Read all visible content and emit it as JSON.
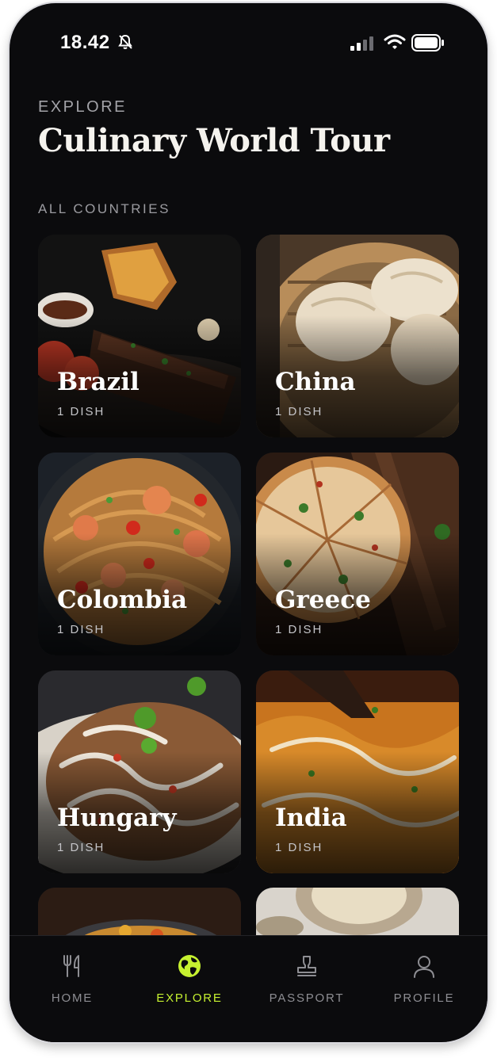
{
  "status_bar": {
    "time": "18.42",
    "icons": [
      "bell-slash-icon",
      "signal-icon",
      "wifi-icon",
      "battery-icon"
    ]
  },
  "header": {
    "eyebrow": "EXPLORE",
    "title": "Culinary World Tour"
  },
  "section_label": "ALL COUNTRIES",
  "countries": [
    {
      "name": "Brazil",
      "count": "1 DISH"
    },
    {
      "name": "China",
      "count": "1 DISH"
    },
    {
      "name": "Colombia",
      "count": "1 DISH"
    },
    {
      "name": "Greece",
      "count": "1 DISH"
    },
    {
      "name": "Hungary",
      "count": "1 DISH"
    },
    {
      "name": "India",
      "count": "1 DISH"
    }
  ],
  "tabs": [
    {
      "label": "HOME",
      "icon": "fork-knife-icon",
      "active": false
    },
    {
      "label": "EXPLORE",
      "icon": "globe-icon",
      "active": true
    },
    {
      "label": "PASSPORT",
      "icon": "stamp-icon",
      "active": false
    },
    {
      "label": "PROFILE",
      "icon": "user-icon",
      "active": false
    }
  ],
  "colors": {
    "accent": "#c6f130",
    "background": "#0b0b0d"
  }
}
